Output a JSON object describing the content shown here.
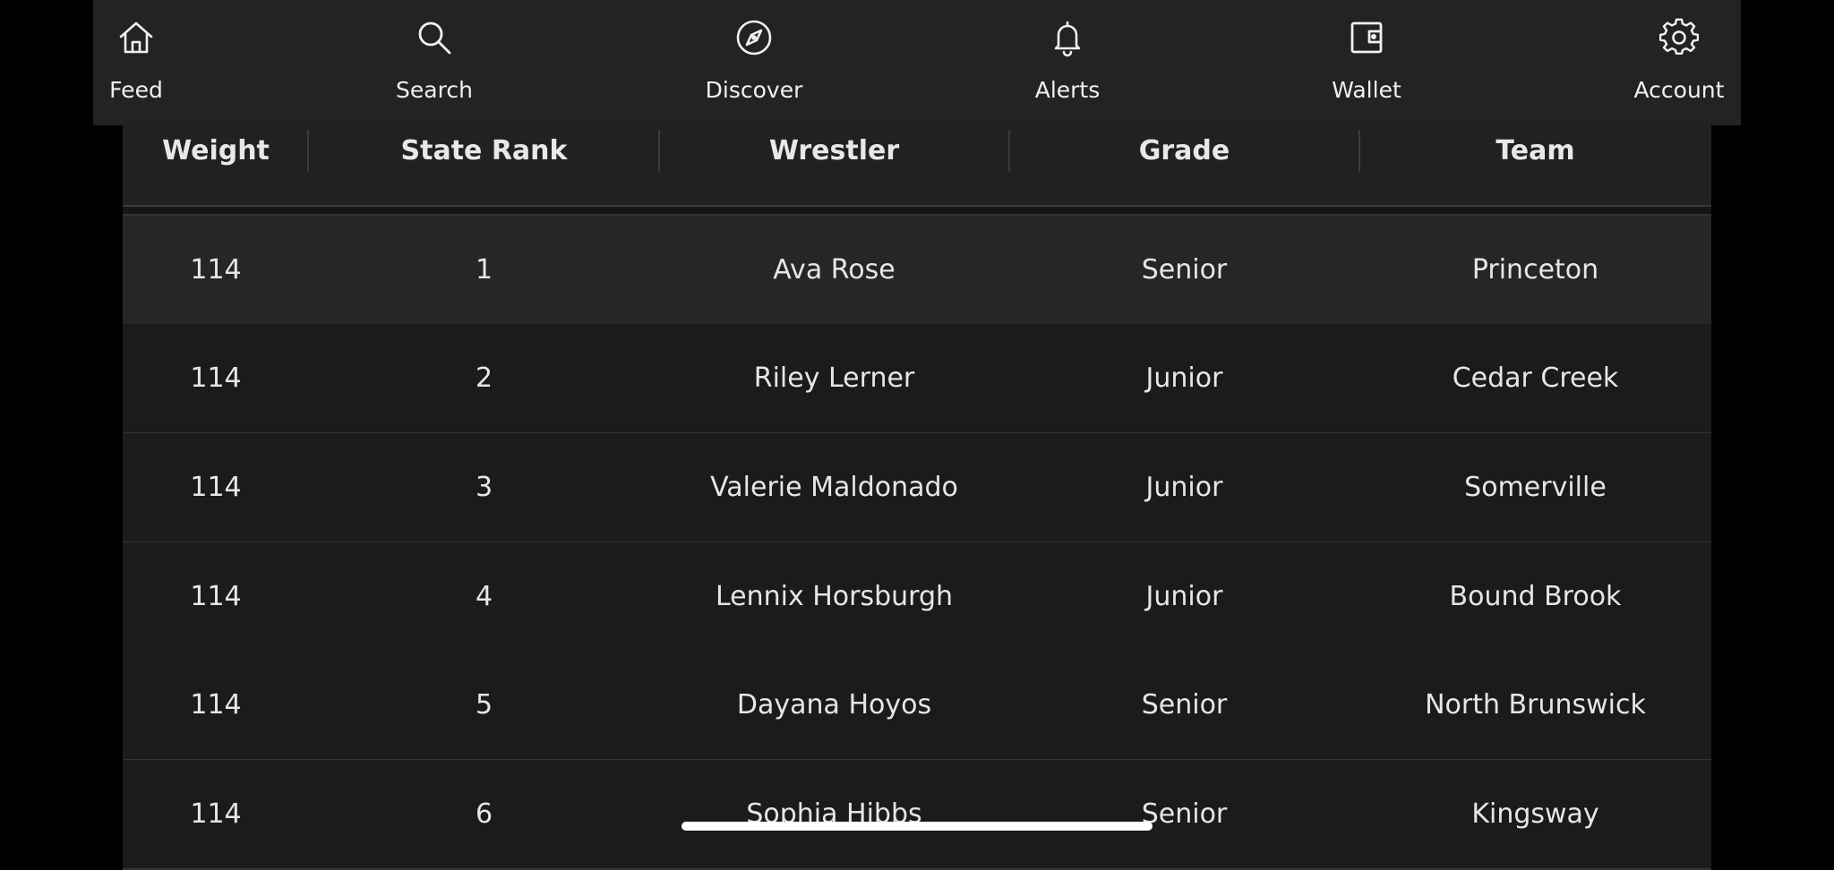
{
  "nav": {
    "items": [
      {
        "label": "Feed",
        "icon": "home-icon"
      },
      {
        "label": "Search",
        "icon": "search-icon"
      },
      {
        "label": "Discover",
        "icon": "compass-icon"
      },
      {
        "label": "Alerts",
        "icon": "bell-icon"
      },
      {
        "label": "Wallet",
        "icon": "wallet-icon"
      },
      {
        "label": "Account",
        "icon": "gear-icon"
      }
    ]
  },
  "table": {
    "columns": [
      "Weight",
      "State Rank",
      "Wrestler",
      "Grade",
      "Team"
    ],
    "rows": [
      [
        "114",
        "1",
        "Ava Rose",
        "Senior",
        "Princeton"
      ],
      [
        "114",
        "2",
        "Riley Lerner",
        "Junior",
        "Cedar Creek"
      ],
      [
        "114",
        "3",
        "Valerie Maldonado",
        "Junior",
        "Somerville"
      ],
      [
        "114",
        "4",
        "Lennix Horsburgh",
        "Junior",
        "Bound Brook"
      ],
      [
        "114",
        "5",
        "Dayana Hoyos",
        "Senior",
        "North Brunswick"
      ],
      [
        "114",
        "6",
        "Sophia Hibbs",
        "Senior",
        "Kingsway"
      ]
    ]
  }
}
